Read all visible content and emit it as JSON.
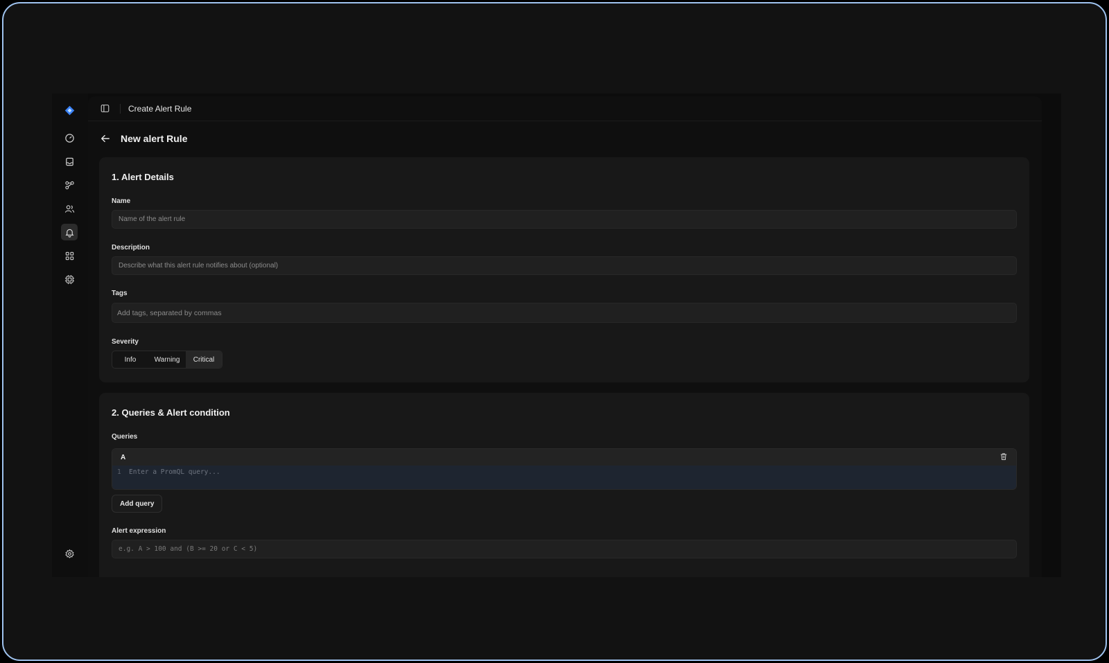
{
  "topbar": {
    "breadcrumb": "Create Alert Rule"
  },
  "page": {
    "title": "New alert Rule"
  },
  "alert_details": {
    "heading": "1. Alert Details",
    "name_label": "Name",
    "name_placeholder": "Name of the alert rule",
    "description_label": "Description",
    "description_placeholder": "Describe what this alert rule notifies about (optional)",
    "tags_label": "Tags",
    "tags_placeholder": "Add tags, separated by commas",
    "severity_label": "Severity",
    "severity_options": [
      "Info",
      "Warning",
      "Critical"
    ],
    "severity_selected": "Critical"
  },
  "queries_section": {
    "heading": "2. Queries & Alert condition",
    "queries_label": "Queries",
    "query": {
      "id": "A",
      "line_number": "1",
      "placeholder": "Enter a PromQL query..."
    },
    "add_query_label": "Add query",
    "expression_label": "Alert expression",
    "expression_placeholder": "e.g. A > 100 and (B >= 20 or C < 5)"
  },
  "sidebar": {
    "items": [
      "dashboard-icon",
      "inbox-icon",
      "workflow-icon",
      "users-icon",
      "bell-icon",
      "apps-icon",
      "cpu-icon"
    ],
    "active": "bell-icon",
    "footer": "settings-icon"
  },
  "colors": {
    "accent": "#3b82f6",
    "frame_border": "#9fc3ef"
  }
}
